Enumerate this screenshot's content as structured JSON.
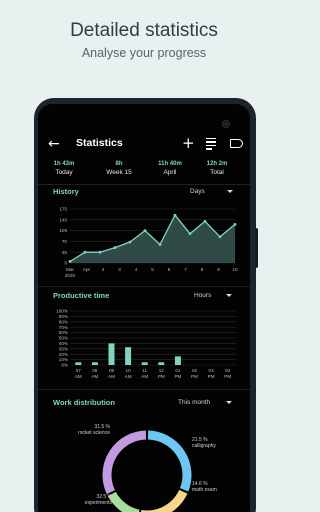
{
  "promo": {
    "title": "Detailed statistics",
    "subtitle": "Analyse your progress"
  },
  "toolbar": {
    "title": "Statistics"
  },
  "summary": [
    {
      "value": "1h 43m",
      "label": "Today"
    },
    {
      "value": "8h",
      "label": "Week 15"
    },
    {
      "value": "11h 40m",
      "label": "April"
    },
    {
      "value": "12h 2m",
      "label": "Total"
    }
  ],
  "history": {
    "title": "History",
    "period": "Days",
    "chart_data": {
      "type": "area",
      "x": [
        "Mar 2020",
        "Apr",
        "2",
        "3",
        "4",
        "5",
        "6",
        "7",
        "8",
        "9",
        "10"
      ],
      "y_ticks": [
        "175",
        "140",
        "105",
        "70",
        "35",
        "0"
      ],
      "values": [
        5,
        35,
        35,
        50,
        68,
        105,
        60,
        155,
        95,
        135,
        85,
        125
      ],
      "ylim": [
        0,
        175
      ],
      "grid": true,
      "color": "#7fd4c3"
    }
  },
  "productive": {
    "title": "Productive time",
    "period": "Hours",
    "chart_data": {
      "type": "bar",
      "categories": [
        "07 AM",
        "08 AM",
        "09 AM",
        "10 AM",
        "11 AM",
        "12 PM",
        "01 PM",
        "02 PM",
        "03 PM",
        "04 PM"
      ],
      "values": [
        5,
        5,
        40,
        33,
        5,
        5,
        16,
        0,
        0,
        0
      ],
      "y_ticks": [
        "100%",
        "90%",
        "80%",
        "70%",
        "60%",
        "50%",
        "40%",
        "30%",
        "20%",
        "10%",
        "0%"
      ],
      "ylim": [
        0,
        100
      ],
      "color": "#7fd4c3"
    }
  },
  "distribution": {
    "title": "Work distribution",
    "period": "This month",
    "chart_data": {
      "type": "pie",
      "slices": [
        {
          "label": "rocket science",
          "pct": "31.5 %",
          "value": 31.5,
          "color": "#6ec6f2"
        },
        {
          "label": "calligraphy",
          "pct": "21.5 %",
          "value": 21.5,
          "color": "#f7d58a"
        },
        {
          "label": "math exam",
          "pct": "14.6 %",
          "value": 14.6,
          "color": "#a9dd9c"
        },
        {
          "label": "experiments",
          "pct": "32.5 %",
          "value": 32.5,
          "color": "#c29be0"
        }
      ]
    }
  }
}
